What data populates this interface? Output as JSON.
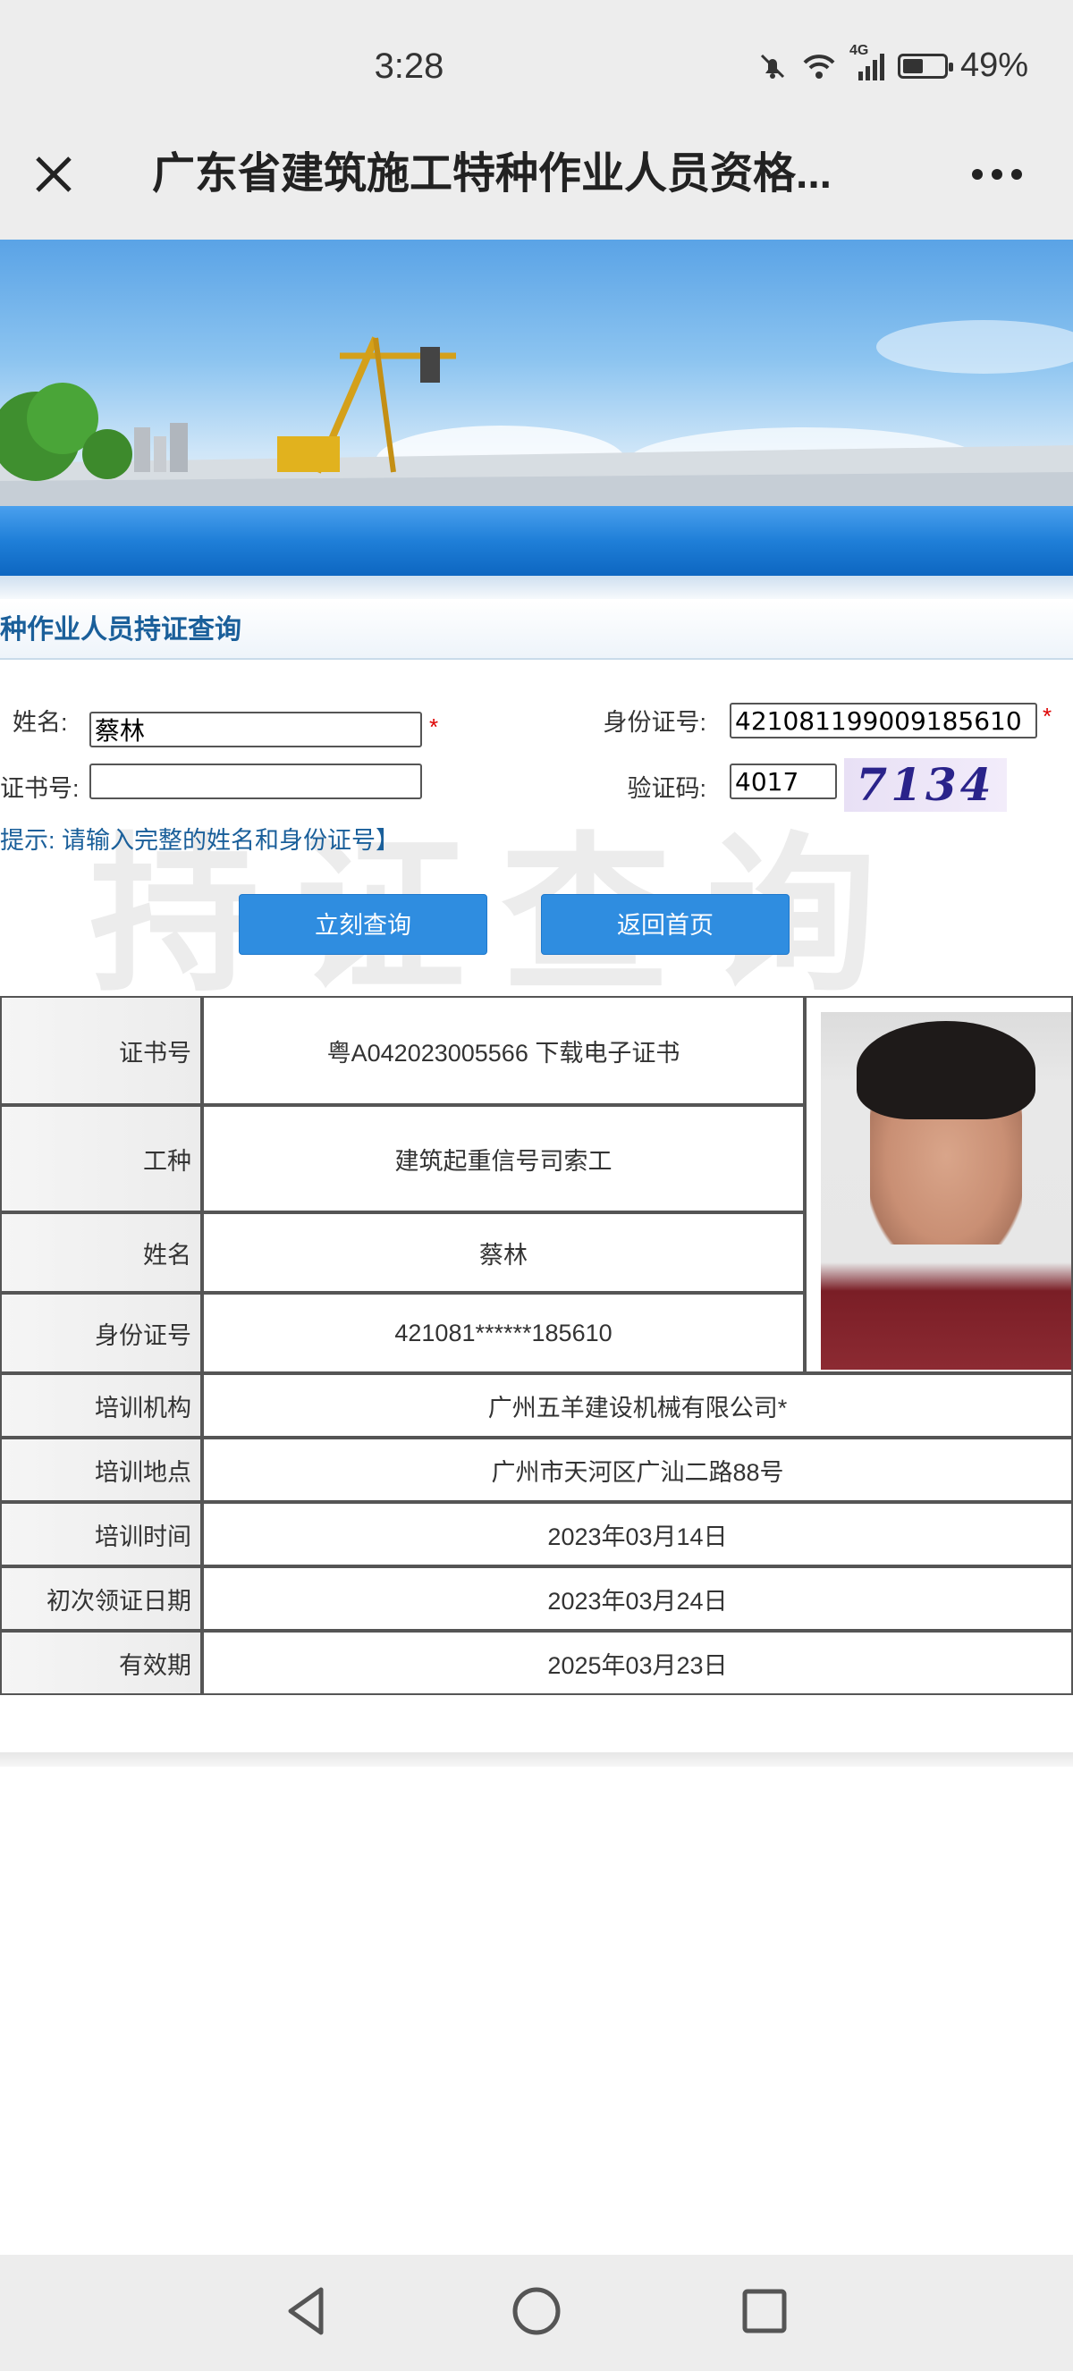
{
  "status_bar": {
    "time": "3:28",
    "network": "4G",
    "battery": "49%"
  },
  "nav": {
    "title": "广东省建筑施工特种作业人员资格...",
    "close_icon": "close-icon",
    "more_icon": "more-icon"
  },
  "section": {
    "title": "种作业人员持证查询"
  },
  "form": {
    "name_label": "姓名:",
    "name_value": "蔡林",
    "cert_label": "证书号:",
    "cert_value": "",
    "id_label": "身份证号:",
    "id_value": "421081199009185610",
    "captcha_label": "验证码:",
    "captcha_value": "4017",
    "captcha_image_text": "7134",
    "required_mark": "*",
    "hint": "提示:  请输入完整的姓名和身份证号】",
    "watermark": "持证查询",
    "query_button": "立刻查询",
    "home_button": "返回首页"
  },
  "result": {
    "rows": [
      {
        "label": "证书号",
        "value": "粤A042023005566  下载电子证书"
      },
      {
        "label": "工种",
        "value": "建筑起重信号司索工"
      },
      {
        "label": "姓名",
        "value": "蔡林"
      },
      {
        "label": "身份证号",
        "value": "421081******185610"
      },
      {
        "label": "培训机构",
        "value": "广州五羊建设机械有限公司*"
      },
      {
        "label": "培训地点",
        "value": "广州市天河区广汕二路88号"
      },
      {
        "label": "培训时间",
        "value": "2023年03月14日"
      },
      {
        "label": "初次领证日期",
        "value": "2023年03月24日"
      },
      {
        "label": "有效期",
        "value": "2025年03月23日"
      }
    ]
  },
  "system_nav": {
    "back_icon": "back-triangle-icon",
    "home_icon": "home-circle-icon",
    "recents_icon": "recents-square-icon"
  },
  "colors": {
    "primary": "#2f8de0",
    "section_text": "#1a5f9a",
    "required": "#dd0000"
  }
}
